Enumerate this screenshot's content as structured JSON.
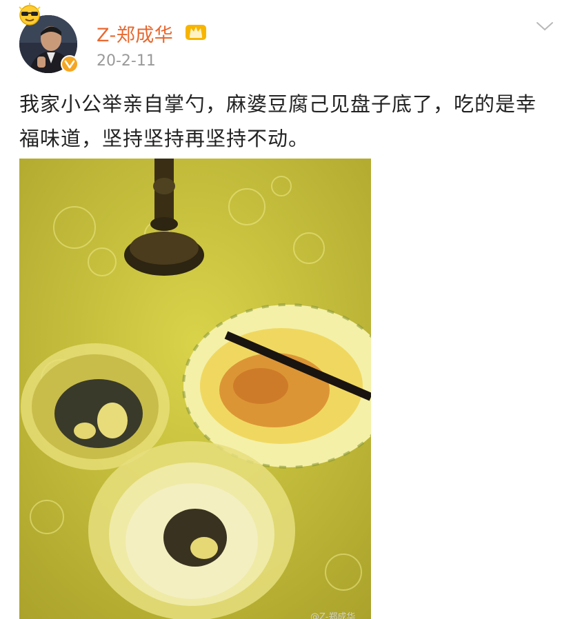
{
  "post": {
    "author": {
      "name": "Z-郑成华",
      "avatar_icon": "user-avatar",
      "badge_icon": "sunglasses-emoji-icon",
      "verified_icon": "verified-v-icon",
      "vip_icon": "crown-vip-icon"
    },
    "date": "20-2-11",
    "text": "我家小公举亲自掌勺，麻婆豆腐己见盘子底了，吃的是幸福味道，坚持坚持再坚持不动。",
    "menu_icon": "chevron-down-icon",
    "image": {
      "description_icon": "photo-dinner-table",
      "watermark": "@Z-郑成华"
    }
  },
  "colors": {
    "username": "#e8682f",
    "date": "#999999",
    "text": "#222222",
    "verified": "#f5a623"
  }
}
